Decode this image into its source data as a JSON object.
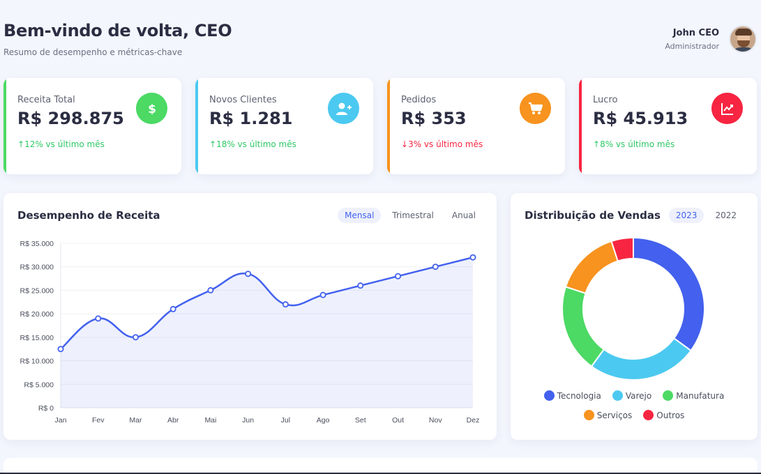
{
  "header": {
    "title": "Bem-vindo de volta, CEO",
    "subtitle": "Resumo de desempenho e métricas-chave"
  },
  "user": {
    "name": "John CEO",
    "role": "Administrador"
  },
  "cards": [
    {
      "label": "Receita Total",
      "value": "R$ 298.875",
      "arrow": "↑",
      "change": "12% vs último mês",
      "trend": "up",
      "accent": "#4cd964",
      "icon": "dollar-icon"
    },
    {
      "label": "Novos Clientes",
      "value": "R$ 1.281",
      "arrow": "↑",
      "change": "18% vs último mês",
      "trend": "up",
      "accent": "#4cc9f0",
      "icon": "user-plus-icon"
    },
    {
      "label": "Pedidos",
      "value": "R$ 353",
      "arrow": "↓",
      "change": "3% vs último mês",
      "trend": "down",
      "accent": "#f7931e",
      "icon": "cart-icon"
    },
    {
      "label": "Lucro",
      "value": "R$ 45.913",
      "arrow": "↑",
      "change": "8% vs último mês",
      "trend": "up",
      "accent": "#f72541",
      "icon": "chart-line-icon"
    }
  ],
  "revenue": {
    "title": "Desempenho de Receita",
    "tabs": [
      "Mensal",
      "Trimestral",
      "Anual"
    ],
    "active_tab": 0
  },
  "distribution": {
    "title": "Distribuição de Vendas",
    "tabs": [
      "2023",
      "2022"
    ],
    "active_tab": 0
  },
  "colors": {
    "up": "#2ec866",
    "down": "#f72541",
    "primary": "#4361ee"
  },
  "chart_data": [
    {
      "type": "area",
      "x": [
        "Jan",
        "Fev",
        "Mar",
        "Abr",
        "Mai",
        "Jun",
        "Jul",
        "Ago",
        "Set",
        "Out",
        "Nov",
        "Dez"
      ],
      "values": [
        12500,
        19000,
        15000,
        21000,
        25000,
        28500,
        22000,
        24000,
        26000,
        28000,
        30000,
        32000
      ],
      "ylim": [
        0,
        35000
      ],
      "yticks": [
        0,
        5000,
        10000,
        15000,
        20000,
        25000,
        30000,
        35000
      ],
      "ytick_labels": [
        "R$ 0",
        "R$ 5.000",
        "R$ 10.000",
        "R$ 15.000",
        "R$ 20.000",
        "R$ 25.000",
        "R$ 30.000",
        "R$ 35.000"
      ],
      "grid": true,
      "line_color": "#4361ee"
    },
    {
      "type": "pie",
      "style": "doughnut",
      "categories": [
        "Tecnologia",
        "Varejo",
        "Manufatura",
        "Serviços",
        "Outros"
      ],
      "values": [
        35,
        25,
        20,
        15,
        5
      ],
      "colors": [
        "#4361ee",
        "#4cc9f0",
        "#4cd964",
        "#f7931e",
        "#f72541"
      ]
    }
  ]
}
